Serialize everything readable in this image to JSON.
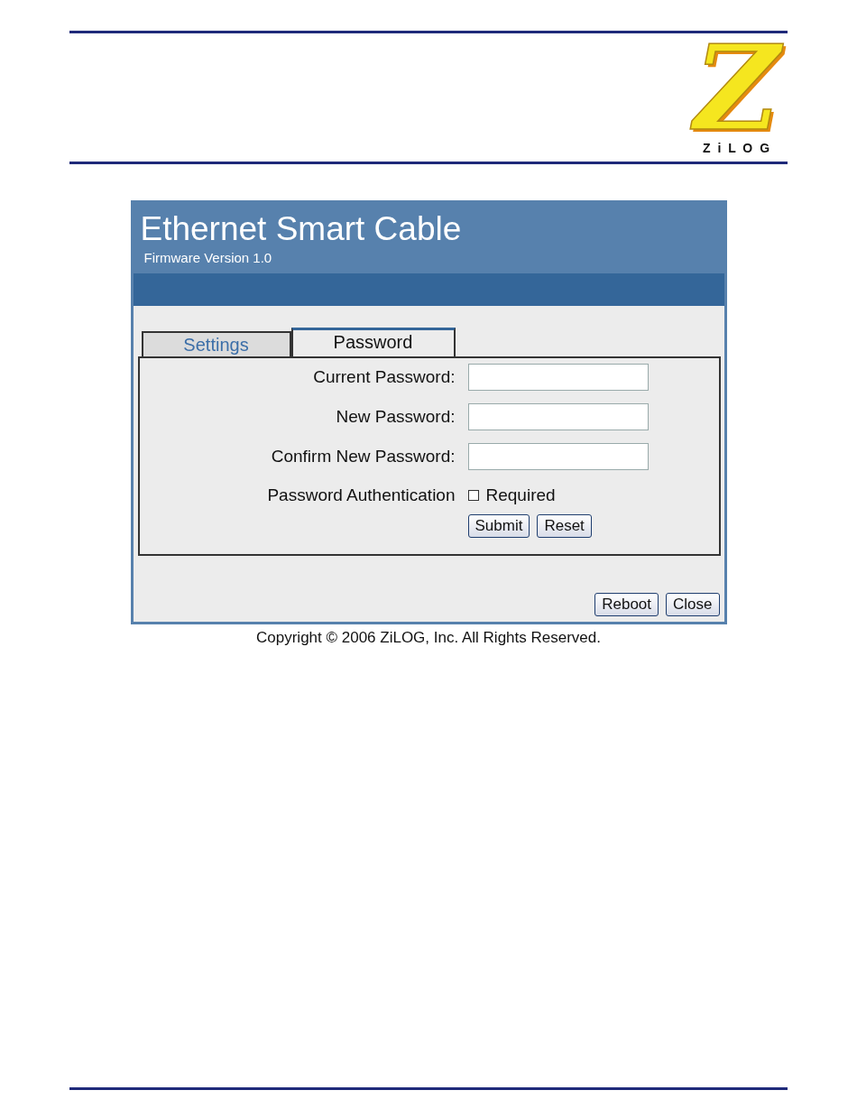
{
  "logo": {
    "mark": "Z",
    "wordmark": "Z i L O G"
  },
  "app": {
    "title": "Ethernet Smart Cable",
    "subtitle": "Firmware Version 1.0"
  },
  "tabs": [
    {
      "label": "Settings",
      "selected": false
    },
    {
      "label": "Password",
      "selected": true
    }
  ],
  "fields": [
    {
      "label": "Current Password:"
    },
    {
      "label": "New Password:"
    },
    {
      "label": "Confirm New Password:"
    }
  ],
  "authentication": {
    "label": "Password Authentication",
    "option": "Required",
    "checked": false
  },
  "form_buttons": [
    "Submit",
    "Reset"
  ],
  "footer_buttons": [
    "Reboot",
    "Close"
  ],
  "copyright": "Copyright © 2006 ZiLOG, Inc. All Rights Reserved."
}
